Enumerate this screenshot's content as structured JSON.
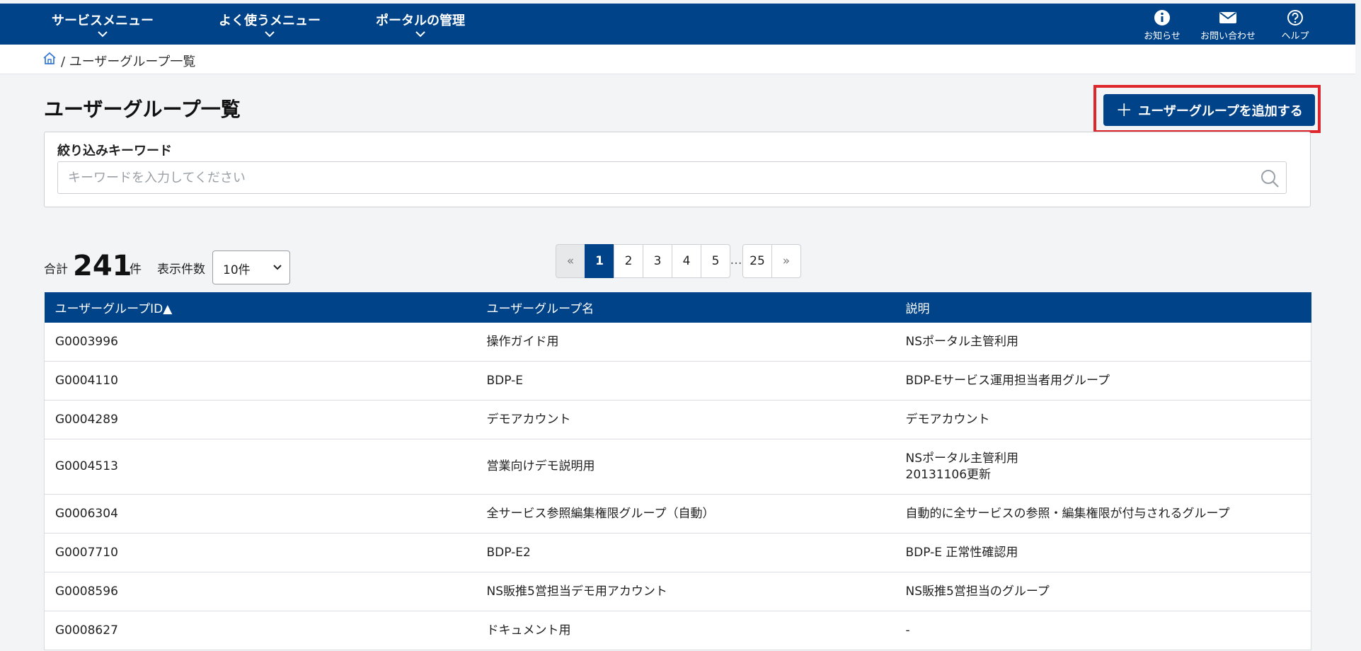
{
  "nav": {
    "menus": [
      {
        "label": "サービスメニュー"
      },
      {
        "label": "よく使うメニュー"
      },
      {
        "label": "ポータルの管理"
      }
    ],
    "utilities": [
      {
        "label": "お知らせ",
        "icon": "info-icon"
      },
      {
        "label": "お問い合わせ",
        "icon": "mail-icon"
      },
      {
        "label": "ヘルプ",
        "icon": "help-icon"
      }
    ]
  },
  "breadcrumb": {
    "text": "/ ユーザーグループ一覧"
  },
  "page": {
    "title": "ユーザーグループ一覧",
    "add_button": "ユーザーグループを追加する"
  },
  "filter": {
    "label": "絞り込みキーワード",
    "placeholder": "キーワードを入力してください",
    "value": ""
  },
  "summary": {
    "prefix": "合計",
    "count": "241",
    "unit": "件",
    "per_page_label": "表示件数",
    "per_page_value": "10件"
  },
  "pagination": {
    "prev": "«",
    "pages": [
      "1",
      "2",
      "3",
      "4",
      "5"
    ],
    "ellipsis": "…",
    "last": "25",
    "next": "»",
    "current": "1"
  },
  "table": {
    "headers": [
      "ユーザーグループID▲",
      "ユーザーグループ名",
      "説明"
    ],
    "rows": [
      {
        "id": "G0003996",
        "name": "操作ガイド用",
        "desc": "NSポータル主管利用",
        "desc2": ""
      },
      {
        "id": "G0004110",
        "name": "BDP-E",
        "desc": "BDP-Eサービス運用担当者用グループ",
        "desc2": ""
      },
      {
        "id": "G0004289",
        "name": "デモアカウント",
        "desc": "デモアカウント",
        "desc2": ""
      },
      {
        "id": "G0004513",
        "name": "営業向けデモ説明用",
        "desc": "NSポータル主管利用",
        "desc2": "20131106更新"
      },
      {
        "id": "G0006304",
        "name": "全サービス参照編集権限グループ（自動）",
        "desc": "自動的に全サービスの参照・編集権限が付与されるグループ",
        "desc2": ""
      },
      {
        "id": "G0007710",
        "name": "BDP-E2",
        "desc": "BDP-E 正常性確認用",
        "desc2": ""
      },
      {
        "id": "G0008596",
        "name": "NS販推5営担当デモ用アカウント",
        "desc": "NS販推5営担当のグループ",
        "desc2": ""
      },
      {
        "id": "G0008627",
        "name": "ドキュメント用",
        "desc": "-",
        "desc2": ""
      }
    ]
  },
  "colors": {
    "brand": "#004388",
    "highlight": "#e0262d"
  }
}
